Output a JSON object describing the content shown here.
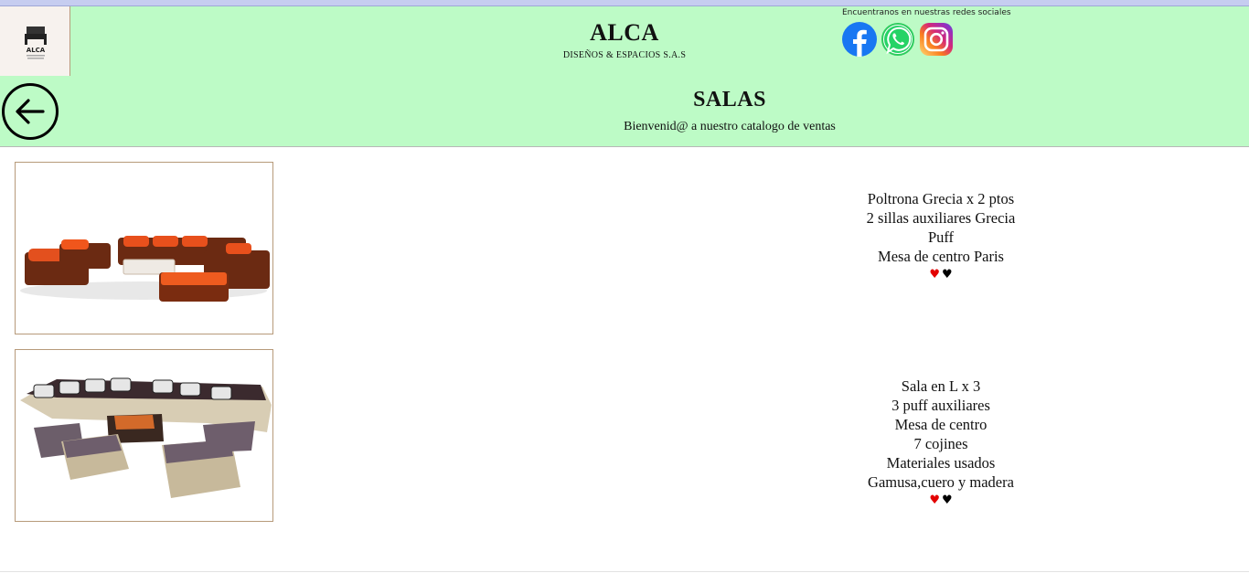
{
  "header": {
    "logo_text": "ALCA",
    "title": "ALCA",
    "subtitle": "DISEÑOS & ESPACIOS S.A.S",
    "social_text": "Encuentranos en nuestras redes sociales",
    "social_icons": [
      "facebook-icon",
      "whatsapp-icon",
      "instagram-icon"
    ]
  },
  "section": {
    "back_icon": "arrow-left-icon",
    "title": "SALAS",
    "subtitle": "Bienvenid@ a nuestro catalogo de ventas"
  },
  "products": [
    {
      "lines": [
        "Poltrona Grecia x 2 ptos",
        "2 sillas auxiliares Grecia",
        "Puff",
        "Mesa de centro Paris"
      ],
      "hearts": [
        "♥",
        "♥"
      ]
    },
    {
      "lines": [
        "Sala en L x 3",
        "3 puff auxiliares",
        "Mesa de centro",
        "7 cojines",
        "Materiales usados",
        "Gamusa,cuero y madera"
      ],
      "hearts": [
        "♥",
        "♥"
      ]
    }
  ],
  "colors": {
    "band": "#bdfbc6",
    "heart_like": "#e30000",
    "heart_dark": "#000000"
  }
}
